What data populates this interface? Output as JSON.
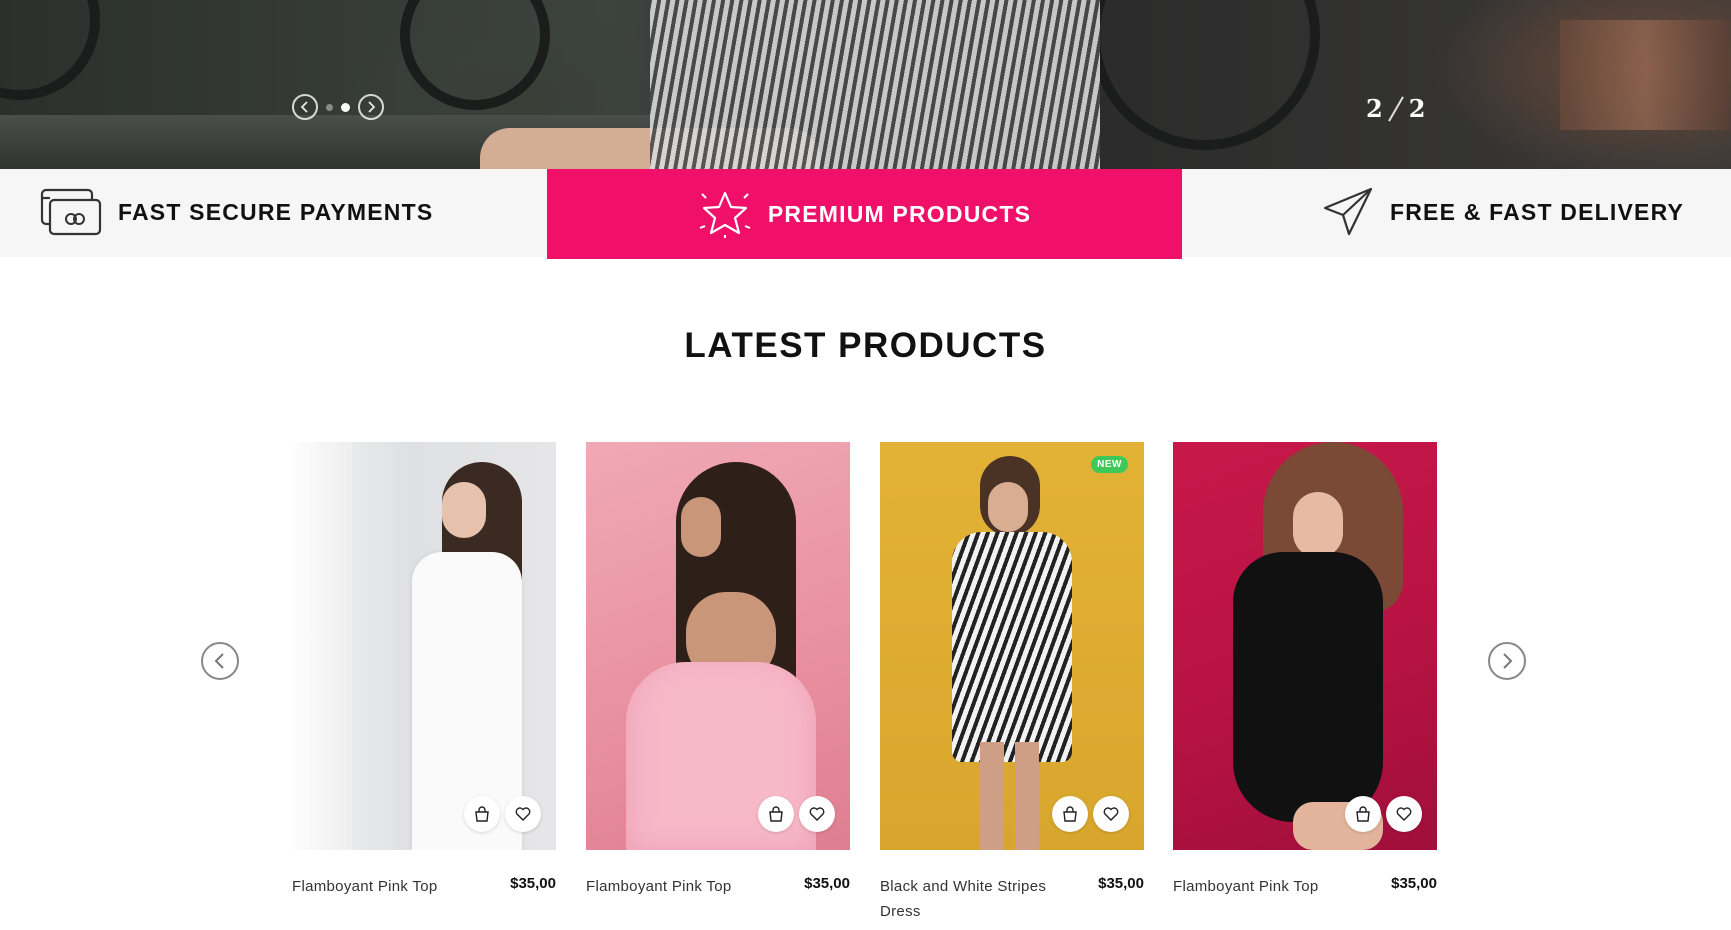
{
  "hero": {
    "counter_current": "2",
    "counter_total": "2",
    "dots": [
      "slide-1",
      "slide-2"
    ],
    "active_dot": 1
  },
  "features": [
    {
      "label": "FAST SECURE PAYMENTS",
      "icon": "credit-card-icon"
    },
    {
      "label": "PREMIUM PRODUCTS",
      "icon": "star-icon"
    },
    {
      "label": "FREE & FAST DELIVERY",
      "icon": "paper-plane-icon"
    }
  ],
  "colors": {
    "accent": "#f0106a",
    "new_badge": "#3cc95a",
    "feature_bg": "#f6f6f6"
  },
  "latest": {
    "title": "LATEST PRODUCTS",
    "products": [
      {
        "name": "Flamboyant Pink Top",
        "price": "$35,00",
        "badge": ""
      },
      {
        "name": "Flamboyant Pink Top",
        "price": "$35,00",
        "badge": ""
      },
      {
        "name": "Black and White Stripes Dress",
        "price": "$35,00",
        "badge": "NEW"
      },
      {
        "name": "Flamboyant Pink Top",
        "price": "$35,00",
        "badge": ""
      }
    ]
  }
}
